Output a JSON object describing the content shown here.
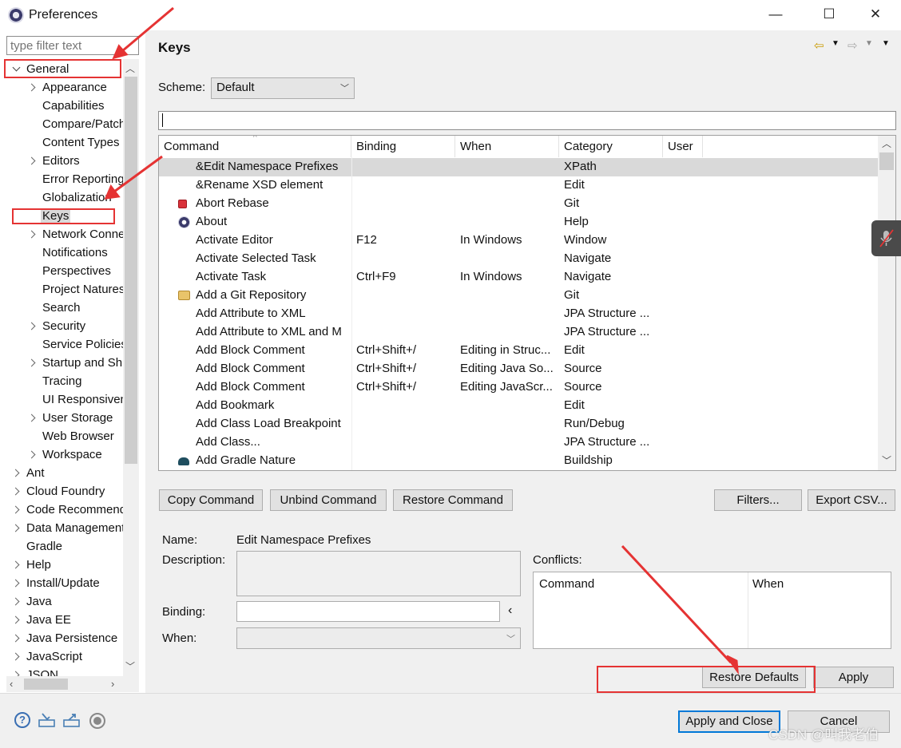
{
  "window": {
    "title": "Preferences",
    "min_glyph": "—",
    "max_glyph": "☐",
    "close_glyph": "✕"
  },
  "left": {
    "filter_placeholder": "type filter text",
    "tree": [
      {
        "label": "General",
        "level": 0,
        "twisty": "open"
      },
      {
        "label": "Appearance",
        "level": 1,
        "twisty": "closed"
      },
      {
        "label": "Capabilities",
        "level": 1,
        "twisty": ""
      },
      {
        "label": "Compare/Patch",
        "level": 1,
        "twisty": ""
      },
      {
        "label": "Content Types",
        "level": 1,
        "twisty": ""
      },
      {
        "label": "Editors",
        "level": 1,
        "twisty": "closed"
      },
      {
        "label": "Error Reporting",
        "level": 1,
        "twisty": ""
      },
      {
        "label": "Globalization",
        "level": 1,
        "twisty": ""
      },
      {
        "label": "Keys",
        "level": 1,
        "twisty": "",
        "selected": true
      },
      {
        "label": "Network Connections",
        "level": 1,
        "twisty": "closed"
      },
      {
        "label": "Notifications",
        "level": 1,
        "twisty": ""
      },
      {
        "label": "Perspectives",
        "level": 1,
        "twisty": ""
      },
      {
        "label": "Project Natures",
        "level": 1,
        "twisty": ""
      },
      {
        "label": "Search",
        "level": 1,
        "twisty": ""
      },
      {
        "label": "Security",
        "level": 1,
        "twisty": "closed"
      },
      {
        "label": "Service Policies",
        "level": 1,
        "twisty": ""
      },
      {
        "label": "Startup and Shutdown",
        "level": 1,
        "twisty": "closed"
      },
      {
        "label": "Tracing",
        "level": 1,
        "twisty": ""
      },
      {
        "label": "UI Responsiveness",
        "level": 1,
        "twisty": ""
      },
      {
        "label": "User Storage",
        "level": 1,
        "twisty": "closed"
      },
      {
        "label": "Web Browser",
        "level": 1,
        "twisty": ""
      },
      {
        "label": "Workspace",
        "level": 1,
        "twisty": "closed"
      },
      {
        "label": "Ant",
        "level": 0,
        "twisty": "closed"
      },
      {
        "label": "Cloud Foundry",
        "level": 0,
        "twisty": "closed"
      },
      {
        "label": "Code Recommenders",
        "level": 0,
        "twisty": "closed"
      },
      {
        "label": "Data Management",
        "level": 0,
        "twisty": "closed"
      },
      {
        "label": "Gradle",
        "level": 0,
        "twisty": ""
      },
      {
        "label": "Help",
        "level": 0,
        "twisty": "closed"
      },
      {
        "label": "Install/Update",
        "level": 0,
        "twisty": "closed"
      },
      {
        "label": "Java",
        "level": 0,
        "twisty": "closed"
      },
      {
        "label": "Java EE",
        "level": 0,
        "twisty": "closed"
      },
      {
        "label": "Java Persistence",
        "level": 0,
        "twisty": "closed"
      },
      {
        "label": "JavaScript",
        "level": 0,
        "twisty": "closed"
      },
      {
        "label": "JSON",
        "level": 0,
        "twisty": "closed"
      }
    ]
  },
  "page": {
    "title": "Keys",
    "scheme_label": "Scheme:",
    "scheme_value": "Default",
    "columns": [
      "Command",
      "Binding",
      "When",
      "Category",
      "User"
    ],
    "rows": [
      {
        "icon": "",
        "command": "&Edit Namespace Prefixes",
        "binding": "",
        "when": "",
        "category": "XPath",
        "selected": true
      },
      {
        "icon": "",
        "command": "&Rename XSD element",
        "binding": "",
        "when": "",
        "category": "Edit"
      },
      {
        "icon": "abort-rebase-icon",
        "command": "Abort Rebase",
        "binding": "",
        "when": "",
        "category": "Git"
      },
      {
        "icon": "eclipse-about-icon",
        "command": "About",
        "binding": "",
        "when": "",
        "category": "Help"
      },
      {
        "icon": "",
        "command": "Activate Editor",
        "binding": "F12",
        "when": "In Windows",
        "category": "Window"
      },
      {
        "icon": "",
        "command": "Activate Selected Task",
        "binding": "",
        "when": "",
        "category": "Navigate"
      },
      {
        "icon": "",
        "command": "Activate Task",
        "binding": "Ctrl+F9",
        "when": "In Windows",
        "category": "Navigate"
      },
      {
        "icon": "git-repository-icon",
        "command": "Add a Git Repository",
        "binding": "",
        "when": "",
        "category": "Git"
      },
      {
        "icon": "",
        "command": "Add Attribute to XML",
        "binding": "",
        "when": "",
        "category": "JPA Structure ..."
      },
      {
        "icon": "",
        "command": "Add Attribute to XML and M",
        "binding": "",
        "when": "",
        "category": "JPA Structure ..."
      },
      {
        "icon": "",
        "command": "Add Block Comment",
        "binding": "Ctrl+Shift+/",
        "when": "Editing in Struc...",
        "category": "Edit"
      },
      {
        "icon": "",
        "command": "Add Block Comment",
        "binding": "Ctrl+Shift+/",
        "when": "Editing Java So...",
        "category": "Source"
      },
      {
        "icon": "",
        "command": "Add Block Comment",
        "binding": "Ctrl+Shift+/",
        "when": "Editing JavaScr...",
        "category": "Source"
      },
      {
        "icon": "",
        "command": "Add Bookmark",
        "binding": "",
        "when": "",
        "category": "Edit"
      },
      {
        "icon": "",
        "command": "Add Class Load Breakpoint",
        "binding": "",
        "when": "",
        "category": "Run/Debug"
      },
      {
        "icon": "",
        "command": "Add Class...",
        "binding": "",
        "when": "",
        "category": "JPA Structure ..."
      },
      {
        "icon": "gradle-elephant-icon",
        "command": "Add Gradle Nature",
        "binding": "",
        "when": "",
        "category": "Buildship"
      }
    ],
    "buttons": {
      "copy": "Copy Command",
      "unbind": "Unbind Command",
      "restore_cmd": "Restore Command",
      "filters": "Filters...",
      "export": "Export CSV..."
    },
    "details": {
      "name_label": "Name:",
      "name_value": "Edit Namespace Prefixes",
      "description_label": "Description:",
      "binding_label": "Binding:",
      "binding_value": "",
      "binding_arrow": "‹",
      "when_label": "When:",
      "conflicts_label": "Conflicts:",
      "conflicts_columns": [
        "Command",
        "When"
      ]
    },
    "restore_defaults": "Restore Defaults",
    "apply": "Apply"
  },
  "footer": {
    "apply_close": "Apply and Close",
    "cancel": "Cancel",
    "watermark": "CSDN @叫我老伯"
  },
  "colors": {
    "annotation_red": "#e53333",
    "accent_blue": "#0078d7"
  }
}
